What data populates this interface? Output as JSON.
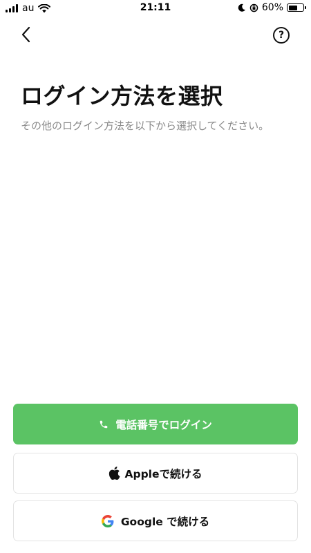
{
  "status_bar": {
    "carrier": "au",
    "time": "21:11",
    "battery": "60%",
    "battery_level": 0.6
  },
  "nav": {
    "back_icon": "chevron-left-icon",
    "help_label": "?"
  },
  "title": "ログイン方法を選択",
  "description": "その他のログイン方法を以下から選択してください。",
  "buttons": {
    "phone": "電話番号でログイン",
    "apple": "Appleで続ける",
    "google": "Google で続ける"
  },
  "colors": {
    "primary_green": "#5bc364",
    "description_gray": "#8a8a8a"
  }
}
